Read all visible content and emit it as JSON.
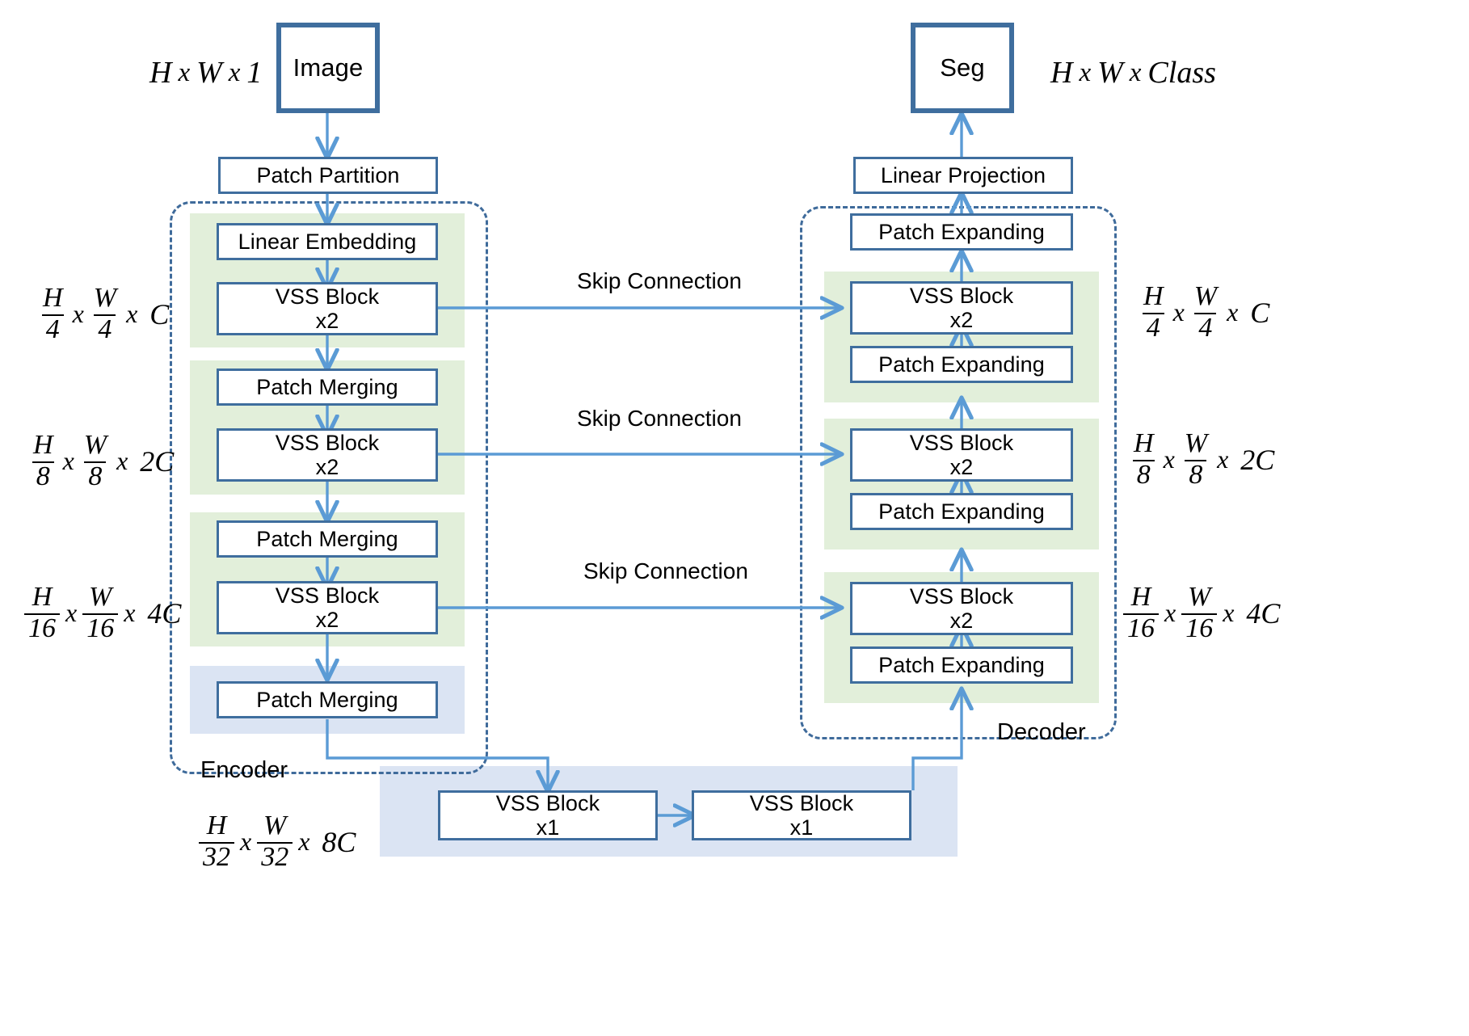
{
  "diagram": {
    "title": "VM-UNet style encoder-decoder architecture",
    "colors": {
      "box_border": "#3f6e9e",
      "arrow": "#5b9bd5",
      "region_dash": "#3f6b9b",
      "group_green": "#e2efda",
      "group_blue": "#dbe4f3",
      "text": "#000000"
    }
  },
  "io": {
    "input_box": "Image",
    "input_dim": {
      "parts": [
        "H",
        "x",
        "W",
        "x",
        "1"
      ]
    },
    "output_box": "Seg",
    "output_dim": {
      "parts": [
        "H",
        "x",
        "W",
        "x",
        "Class"
      ]
    }
  },
  "encoder": {
    "region_label": "Encoder",
    "patch_partition": "Patch Partition",
    "linear_embedding": "Linear Embedding",
    "stages": [
      {
        "vss_label": "VSS Block\nx2",
        "merge_label": "Patch Merging",
        "dim": {
          "num": "H",
          "den": "4",
          "num2": "W",
          "den2": "4",
          "tail": "C"
        }
      },
      {
        "vss_label": "VSS Block\nx2",
        "merge_label": "Patch Merging",
        "dim": {
          "num": "H",
          "den": "8",
          "num2": "W",
          "den2": "8",
          "tail": "2C"
        }
      },
      {
        "vss_label": "VSS Block\nx2",
        "merge_label": "Patch Merging",
        "dim": {
          "num": "H",
          "den": "16",
          "num2": "W",
          "den2": "16",
          "tail": "4C"
        }
      }
    ]
  },
  "bottleneck": {
    "block_1": "VSS Block\nx1",
    "block_2": "VSS Block\nx1",
    "dim": {
      "num": "H",
      "den": "32",
      "num2": "W",
      "den2": "32",
      "tail": "8C"
    }
  },
  "decoder": {
    "region_label": "Decoder",
    "linear_projection": "Linear Projection",
    "top_patch_expanding": "Patch Expanding",
    "stages": [
      {
        "vss_label": "VSS Block\nx2",
        "expand_label": "Patch Expanding",
        "dim": {
          "num": "H",
          "den": "4",
          "num2": "W",
          "den2": "4",
          "tail": "C"
        }
      },
      {
        "vss_label": "VSS Block\nx2",
        "expand_label": "Patch Expanding",
        "dim": {
          "num": "H",
          "den": "8",
          "num2": "W",
          "den2": "8",
          "tail": "2C"
        }
      },
      {
        "vss_label": "VSS Block\nx2",
        "expand_label": "Patch Expanding",
        "dim": {
          "num": "H",
          "den": "16",
          "num2": "W",
          "den2": "16",
          "tail": "4C"
        }
      }
    ]
  },
  "skip_connections": [
    {
      "label": "Skip Connection"
    },
    {
      "label": "Skip Connection"
    },
    {
      "label": "Skip Connection"
    }
  ],
  "symbols": {
    "times": "x"
  }
}
